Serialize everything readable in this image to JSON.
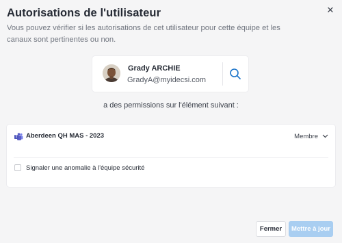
{
  "dialog": {
    "title": "Autorisations de l'utilisateur",
    "description": "Vous pouvez vérifier si les autorisations de cet utilisateur pour cette équipe et les canaux sont pertinentes ou non.",
    "close_icon": "close-icon"
  },
  "user": {
    "name": "Grady ARCHIE",
    "email": "GradyA@myidecsi.com",
    "avatar_icon": "avatar",
    "search_icon": "search-icon"
  },
  "subtitle": "a des permissions sur l'élément suivant :",
  "permission": {
    "team_name": "Aberdeen QH MAS - 2023",
    "team_icon": "teams-icon",
    "role": "Membre",
    "report_label": "Signaler une anomalie à l'équipe sécurité",
    "report_checked": false
  },
  "footer": {
    "close_label": "Fermer",
    "update_label": "Mettre à jour"
  },
  "colors": {
    "accent": "#1a73c9",
    "update_button": "#a9cef1",
    "background": "#f5f5f6",
    "teams_purple": "#5b5fc7"
  }
}
